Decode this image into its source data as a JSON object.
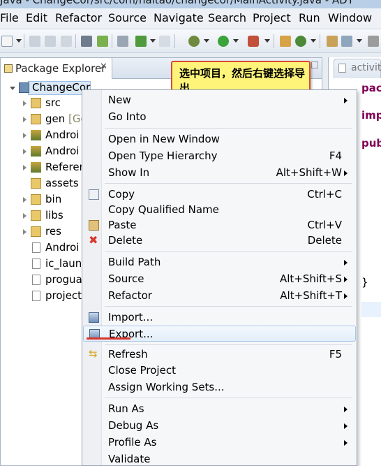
{
  "window": {
    "title": "Java - ChangeCor/src/com/haitao/changecor/MainActivity.java - ADT"
  },
  "menubar": {
    "items": [
      "File",
      "Edit",
      "Refactor",
      "Source",
      "Navigate",
      "Search",
      "Project",
      "Run",
      "Window"
    ]
  },
  "explorer": {
    "title": "Package Explorer",
    "close": "✕",
    "tree": [
      {
        "label": "ChangeCor",
        "icon": "project-icon"
      },
      {
        "label": "src",
        "icon": "source-folder-icon"
      },
      {
        "label": "gen",
        "suffix": "[Ge",
        "icon": "source-folder-icon"
      },
      {
        "label": "Androi",
        "icon": "library-icon"
      },
      {
        "label": "Androi",
        "icon": "library-icon"
      },
      {
        "label": "Referer",
        "icon": "library-icon"
      },
      {
        "label": "assets",
        "icon": "folder-icon"
      },
      {
        "label": "bin",
        "icon": "folder-icon"
      },
      {
        "label": "libs",
        "icon": "folder-icon"
      },
      {
        "label": "res",
        "icon": "folder-icon"
      },
      {
        "label": "Androi",
        "icon": "xml-file-icon"
      },
      {
        "label": "ic_laun",
        "icon": "file-icon"
      },
      {
        "label": "progua",
        "icon": "file-icon"
      },
      {
        "label": "project",
        "icon": "file-icon"
      }
    ]
  },
  "editor": {
    "tab_label": "activity",
    "code": [
      "pac",
      "impo",
      "publ",
      "}"
    ]
  },
  "callout": {
    "text": "选中项目，然后右键选择导出"
  },
  "context_menu": {
    "items": [
      {
        "label": "New",
        "accel": "",
        "submenu": true
      },
      {
        "label": "Go Into",
        "accel": ""
      },
      {
        "label": "Open in New Window",
        "accel": ""
      },
      {
        "label": "Open Type Hierarchy",
        "accel": "F4"
      },
      {
        "label": "Show In",
        "accel": "Alt+Shift+W",
        "submenu": true
      },
      {
        "label": "Copy",
        "accel": "Ctrl+C",
        "icon": "copy-icon"
      },
      {
        "label": "Copy Qualified Name",
        "accel": ""
      },
      {
        "label": "Paste",
        "accel": "Ctrl+V",
        "icon": "paste-icon"
      },
      {
        "label": "Delete",
        "accel": "Delete",
        "icon": "delete-icon"
      },
      {
        "label": "Build Path",
        "accel": "",
        "submenu": true
      },
      {
        "label": "Source",
        "accel": "Alt+Shift+S",
        "submenu": true
      },
      {
        "label": "Refactor",
        "accel": "Alt+Shift+T",
        "submenu": true
      },
      {
        "label": "Import...",
        "accel": "",
        "icon": "import-icon"
      },
      {
        "label": "Export...",
        "accel": "",
        "icon": "export-icon",
        "highlighted": true
      },
      {
        "label": "Refresh",
        "accel": "F5",
        "icon": "refresh-icon"
      },
      {
        "label": "Close Project",
        "accel": ""
      },
      {
        "label": "Assign Working Sets...",
        "accel": ""
      },
      {
        "label": "Run As",
        "accel": "",
        "submenu": true
      },
      {
        "label": "Debug As",
        "accel": "",
        "submenu": true
      },
      {
        "label": "Profile As",
        "accel": "",
        "submenu": true
      },
      {
        "label": "Validate",
        "accel": ""
      }
    ]
  },
  "colors": {
    "callout_bg": "#fff47a",
    "callout_border": "#d84c2e",
    "hover_border": "#a9c7e8",
    "export_underline": "#d8352a",
    "keyword": "#7f0055"
  }
}
